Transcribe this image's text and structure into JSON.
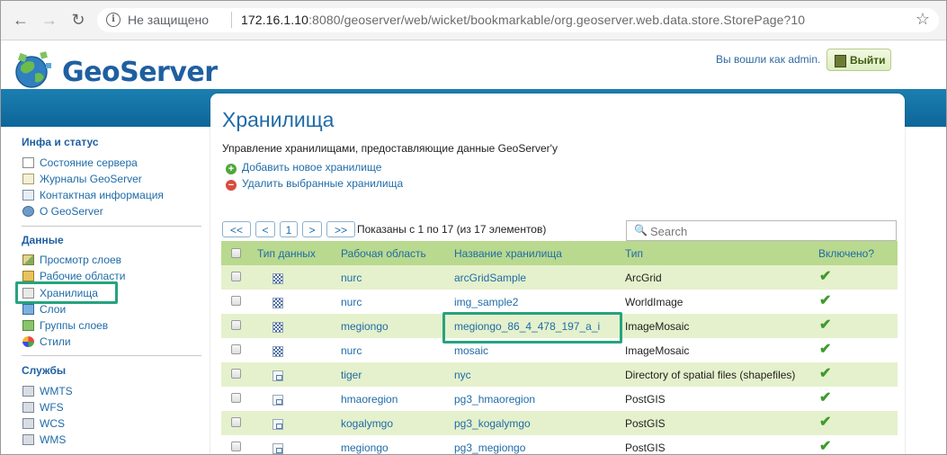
{
  "browser": {
    "back_glyph": "←",
    "forward_glyph": "→",
    "reload_glyph": "↻",
    "info_glyph": "i",
    "security_label": "Не защищено",
    "url_host": "172.16.1.10",
    "url_rest": ":8080/geoserver/web/wicket/bookmarkable/org.geoserver.web.data.store.StorePage?10",
    "star_glyph": "☆"
  },
  "header": {
    "logo_text": "GeoServer",
    "logged_in_text": "Вы вошли как admin.",
    "logout_label": "Выйти"
  },
  "sidebar": {
    "sections": [
      {
        "title": "Инфа и статус",
        "items": [
          {
            "label": "Состояние сервера",
            "icon": "server-status-icon"
          },
          {
            "label": "Журналы GeoServer",
            "icon": "logs-icon"
          },
          {
            "label": "Контактная информация",
            "icon": "contact-icon"
          },
          {
            "label": "О GeoServer",
            "icon": "about-icon"
          }
        ]
      },
      {
        "title": "Данные",
        "items": [
          {
            "label": "Просмотр слоев",
            "icon": "layer-preview-icon"
          },
          {
            "label": "Рабочие области",
            "icon": "workspaces-icon"
          },
          {
            "label": "Хранилища",
            "icon": "stores-icon"
          },
          {
            "label": "Слои",
            "icon": "layers-icon"
          },
          {
            "label": "Группы слоев",
            "icon": "layer-groups-icon"
          },
          {
            "label": "Стили",
            "icon": "styles-icon"
          }
        ]
      },
      {
        "title": "Службы",
        "items": [
          {
            "label": "WMTS",
            "icon": "wmts-icon"
          },
          {
            "label": "WFS",
            "icon": "wfs-icon"
          },
          {
            "label": "WCS",
            "icon": "wcs-icon"
          },
          {
            "label": "WMS",
            "icon": "wms-icon"
          }
        ]
      }
    ]
  },
  "main": {
    "title": "Хранилища",
    "description": "Управление хранилищами, предоставляющие данные GeoServer'у",
    "actions": {
      "add_label": "Добавить новое хранилище",
      "delete_label": "Удалить выбранные хранилища"
    },
    "pager": {
      "first": "<<",
      "prev": "<",
      "page": "1",
      "next": ">",
      "last": ">>",
      "info": "Показаны с 1 по 17 (из 17 элементов)"
    },
    "search": {
      "placeholder": "Search",
      "value": ""
    },
    "table": {
      "columns": [
        "Тип данных",
        "Рабочая область",
        "Название хранилища",
        "Тип",
        "Включено?"
      ],
      "rows": [
        {
          "data_type": "raster",
          "workspace": "nurc",
          "store": "arcGridSample",
          "type": "ArcGrid",
          "enabled": true
        },
        {
          "data_type": "raster",
          "workspace": "nurc",
          "store": "img_sample2",
          "type": "WorldImage",
          "enabled": true
        },
        {
          "data_type": "raster",
          "workspace": "megiongo",
          "store": "megiongo_86_4_478_197_a_i",
          "type": "ImageMosaic",
          "enabled": true
        },
        {
          "data_type": "raster",
          "workspace": "nurc",
          "store": "mosaic",
          "type": "ImageMosaic",
          "enabled": true
        },
        {
          "data_type": "vector",
          "workspace": "tiger",
          "store": "nyc",
          "type": "Directory of spatial files (shapefiles)",
          "enabled": true
        },
        {
          "data_type": "vector",
          "workspace": "hmaoregion",
          "store": "pg3_hmaoregion",
          "type": "PostGIS",
          "enabled": true
        },
        {
          "data_type": "vector",
          "workspace": "kogalymgo",
          "store": "pg3_kogalymgo",
          "type": "PostGIS",
          "enabled": true
        },
        {
          "data_type": "vector",
          "workspace": "megiongo",
          "store": "pg3_megiongo",
          "type": "PostGIS",
          "enabled": true
        }
      ]
    }
  },
  "colors": {
    "accent": "#1f6ba8",
    "highlight": "#25a37f",
    "band": "#0d6699",
    "row_alt": "#e5f1cc",
    "header_row": "#b8d98e"
  }
}
